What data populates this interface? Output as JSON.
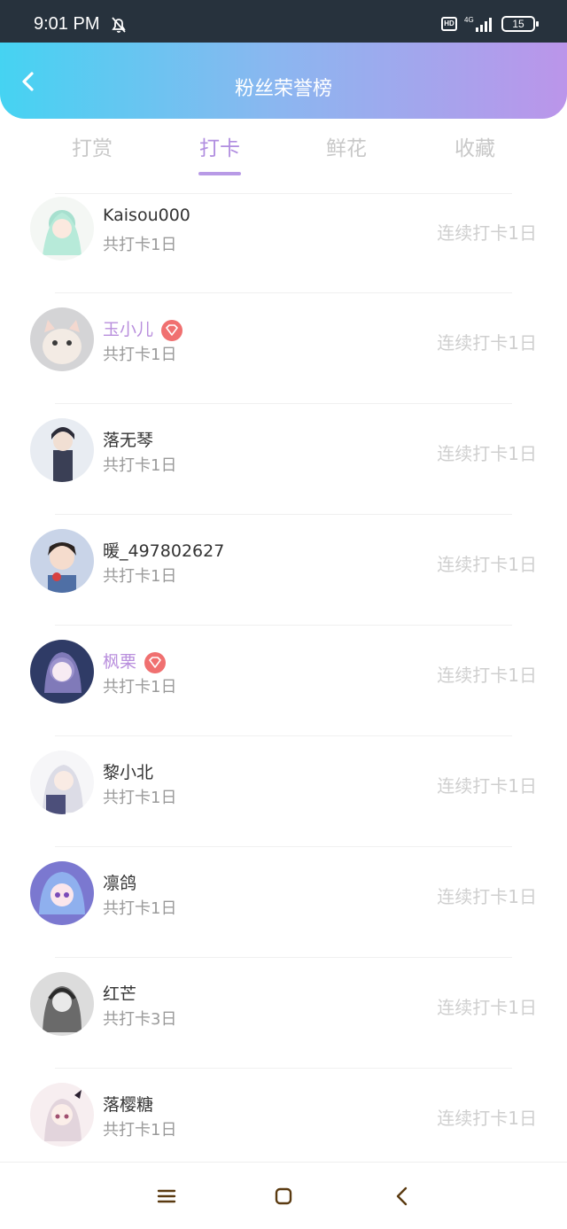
{
  "status_bar": {
    "time": "9:01 PM",
    "network": "4G",
    "hd": "HD",
    "battery": "15"
  },
  "header": {
    "title": "粉丝荣誉榜"
  },
  "tabs": [
    {
      "label": "打赏",
      "active": false
    },
    {
      "label": "打卡",
      "active": true
    },
    {
      "label": "鲜花",
      "active": false
    },
    {
      "label": "收藏",
      "active": false
    }
  ],
  "fans": [
    {
      "name": "Kaisou000",
      "total": "共打卡1日",
      "streak": "连续打卡1日",
      "vip": false
    },
    {
      "name": "玉小儿",
      "total": "共打卡1日",
      "streak": "连续打卡1日",
      "vip": true
    },
    {
      "name": "落无琴",
      "total": "共打卡1日",
      "streak": "连续打卡1日",
      "vip": false
    },
    {
      "name": "暖_497802627",
      "total": "共打卡1日",
      "streak": "连续打卡1日",
      "vip": false
    },
    {
      "name": "枫栗",
      "total": "共打卡1日",
      "streak": "连续打卡1日",
      "vip": true
    },
    {
      "name": "黎小北",
      "total": "共打卡1日",
      "streak": "连续打卡1日",
      "vip": false
    },
    {
      "name": "凛鸽",
      "total": "共打卡1日",
      "streak": "连续打卡1日",
      "vip": false
    },
    {
      "name": "红芒",
      "total": "共打卡3日",
      "streak": "连续打卡1日",
      "vip": false
    },
    {
      "name": "落樱糖",
      "total": "共打卡1日",
      "streak": "连续打卡1日",
      "vip": false
    }
  ],
  "colors": {
    "accent": "#b18ee0",
    "vip_badge": "#f07070",
    "header_start": "#45d3f2",
    "header_end": "#bb95ea"
  },
  "nav_icons": [
    "menu-icon",
    "home-square-icon",
    "back-triangle-icon"
  ]
}
